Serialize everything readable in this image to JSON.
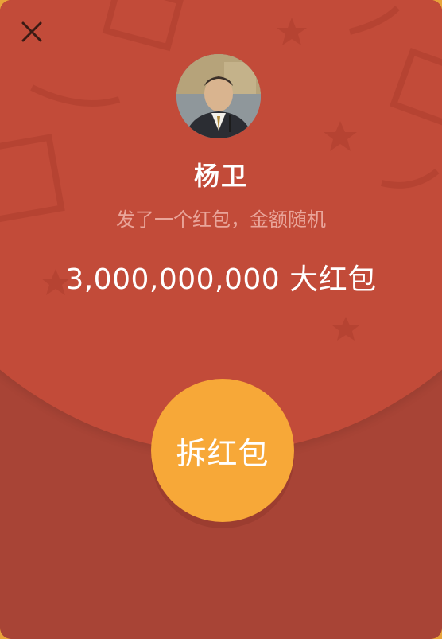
{
  "envelope": {
    "sender_name": "杨卫",
    "subtitle": "发了一个红包，金额随机",
    "amount_text": "3,000,000,000 大红包",
    "open_button_label": "拆红包"
  },
  "icons": {
    "close": "close-icon",
    "avatar": "avatar"
  },
  "colors": {
    "flap_red": "#c24b39",
    "envelope_dark_red": "#a84436",
    "button_orange": "#f7a838",
    "border_orange": "#e8a33a",
    "subtitle_pink": "#e9a59a"
  }
}
